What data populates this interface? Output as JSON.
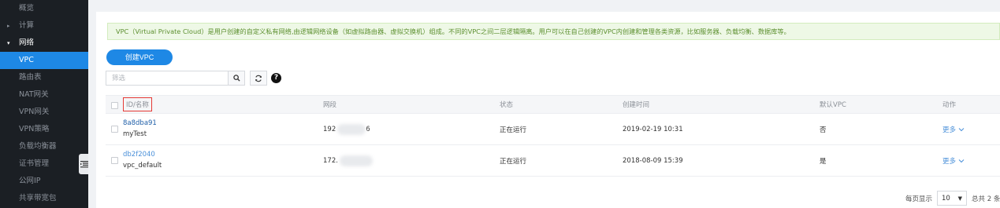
{
  "sidebar": {
    "items": [
      {
        "label": "概览"
      },
      {
        "label": "计算"
      },
      {
        "label": "网络"
      },
      {
        "label": "VPC"
      },
      {
        "label": "路由表"
      },
      {
        "label": "NAT网关"
      },
      {
        "label": "VPN网关"
      },
      {
        "label": "VPN策略"
      },
      {
        "label": "负载均衡器"
      },
      {
        "label": "证书管理"
      },
      {
        "label": "公网IP"
      },
      {
        "label": "共享带宽包"
      }
    ]
  },
  "info": {
    "text": "VPC（Virtual Private Cloud）是用户创建的自定义私有网络,由逻辑网络设备（如虚拟路由器、虚拟交换机）组成。不同的VPC之间二层逻辑隔离。用户可以在自己创建的VPC内创建和管理各类资源，比如服务器、负载均衡、数据库等。"
  },
  "toolbar": {
    "create_label": "创建VPC",
    "filter_placeholder": "筛选"
  },
  "table": {
    "headers": {
      "id_name": "ID/名称",
      "cidr": "网段",
      "state": "状态",
      "created": "创建时间",
      "default_vpc": "默认VPC",
      "action": "动作"
    },
    "rows": [
      {
        "id": "8a8dba91",
        "name": "myTest",
        "cidr_prefix": "192",
        "cidr_suffix": "6",
        "state": "正在运行",
        "created": "2019-02-19 10:31",
        "default_vpc": "否",
        "action": "更多"
      },
      {
        "id": "db2f2040",
        "name": "vpc_default",
        "cidr_prefix": "172.",
        "cidr_suffix": "",
        "state": "正在运行",
        "created": "2018-08-09 15:39",
        "default_vpc": "是",
        "action": "更多"
      }
    ]
  },
  "pagination": {
    "per_page_label": "每页显示",
    "per_page_value": "10",
    "total_label": "总共 2 条"
  },
  "colors": {
    "accent": "#1e88e5",
    "sidebar_bg": "#1b1f24",
    "info_bg": "#eef8e6",
    "highlight_border": "#e53935"
  }
}
